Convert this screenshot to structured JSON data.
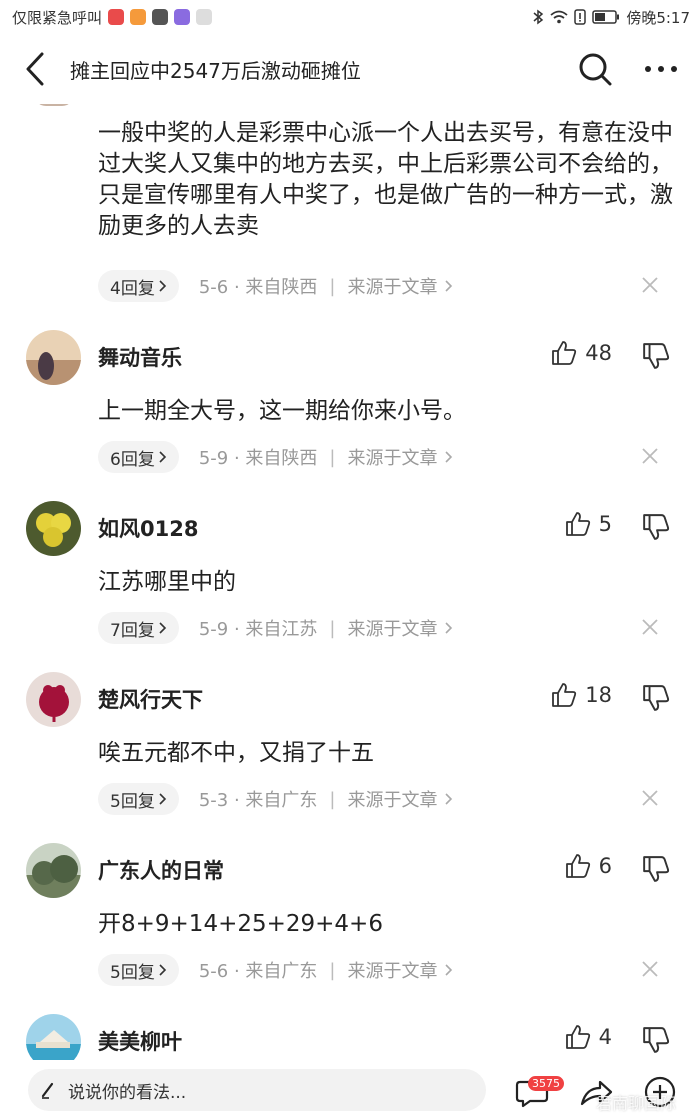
{
  "status_bar": {
    "carrier_text": "仅限紧急呼叫",
    "time": "傍晚5:17"
  },
  "nav": {
    "title": "摊主回应中2547万后激动砸摊位"
  },
  "comments": [
    {
      "text": "一般中奖的人是彩票中心派一个人出去买号，有意在没中过大奖人又集中的地方去买，中上后彩票公司不会给的，只是宣传哪里有人中奖了，也是做广告的一种方一式，激励更多的人去卖",
      "replies": "4回复",
      "meta": "5-6 · 来自陕西",
      "source": "来源于文章"
    },
    {
      "user": "舞动音乐",
      "likes": "48",
      "text": "上一期全大号，这一期给你来小号。",
      "replies": "6回复",
      "meta": "5-9 · 来自陕西",
      "source": "来源于文章"
    },
    {
      "user": "如风0128",
      "likes": "5",
      "text": "江苏哪里中的",
      "replies": "7回复",
      "meta": "5-9 · 来自江苏",
      "source": "来源于文章"
    },
    {
      "user": "楚风行天下",
      "likes": "18",
      "text": "唉五元都不中，又捐了十五",
      "replies": "5回复",
      "meta": "5-3 · 来自广东",
      "source": "来源于文章"
    },
    {
      "user": "广东人的日常",
      "likes": "6",
      "text": "开8+9+14+25+29+4+6",
      "replies": "5回复",
      "meta": "5-6 · 来自广东",
      "source": "来源于文章"
    },
    {
      "user": "美美柳叶",
      "likes": "4"
    }
  ],
  "bottom_bar": {
    "input_placeholder": "说说你的看法...",
    "comment_count_badge": "3575",
    "watermark": "君南聊国际"
  }
}
